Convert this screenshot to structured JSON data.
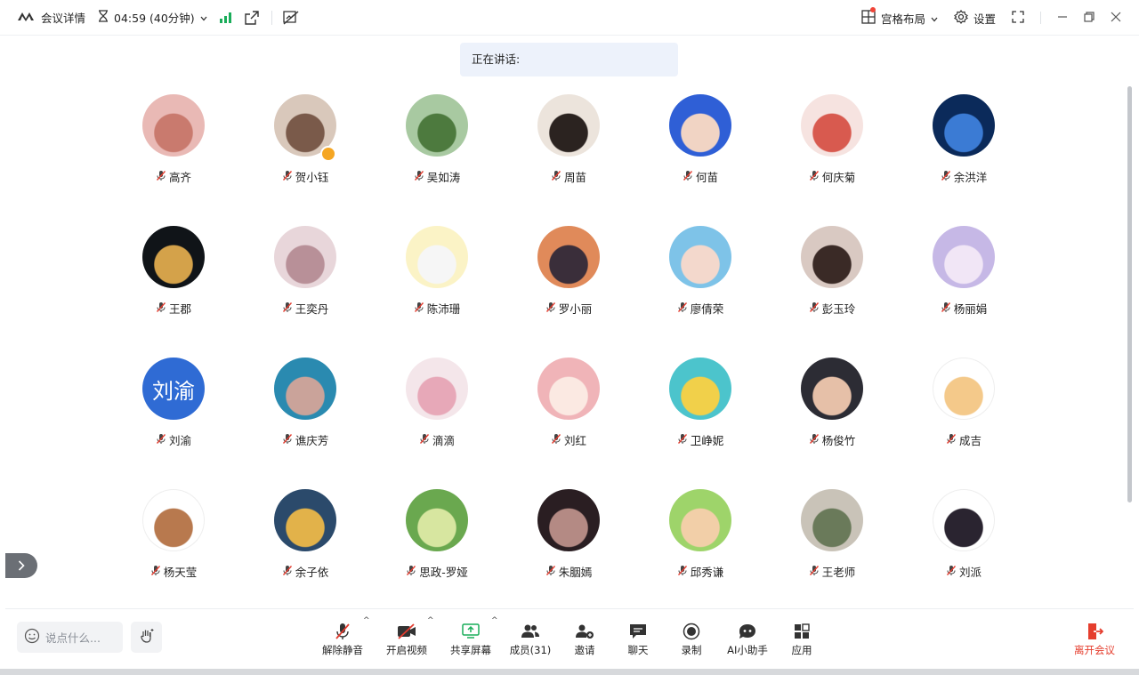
{
  "topbar": {
    "meeting_details": "会议详情",
    "timer": "04:59 (40分钟)",
    "layout_label": "宫格布局",
    "settings_label": "设置"
  },
  "speaking": {
    "label": "正在讲话:"
  },
  "participants": [
    {
      "name": "高齐",
      "avatar": "photo-toddler-pink"
    },
    {
      "name": "贺小钰",
      "avatar": "photo-girl-host"
    },
    {
      "name": "吴如涛",
      "avatar": "photo-man-grass"
    },
    {
      "name": "周苗",
      "avatar": "photo-black-cat"
    },
    {
      "name": "何苗",
      "avatar": "illustration-blue-girl"
    },
    {
      "name": "何庆菊",
      "avatar": "illustration-cartoon-girl"
    },
    {
      "name": "余洪洋",
      "avatar": "photo-earth"
    },
    {
      "name": "王郡",
      "avatar": "photo-clock-tower-night"
    },
    {
      "name": "王奕丹",
      "avatar": "illustration-princess"
    },
    {
      "name": "陈沛珊",
      "avatar": "illustration-white-rabbit"
    },
    {
      "name": "罗小丽",
      "avatar": "photo-sunset"
    },
    {
      "name": "廖倩荣",
      "avatar": "photo-girl-beach"
    },
    {
      "name": "彭玉玲",
      "avatar": "photo-girl-hands"
    },
    {
      "name": "杨丽娟",
      "avatar": "photo-pink-snowfield"
    },
    {
      "name": "刘渝",
      "avatar_text": "刘渝"
    },
    {
      "name": "谯庆芳",
      "avatar": "photo-blue-veil"
    },
    {
      "name": "滴滴",
      "avatar": "photo-baby-bunny"
    },
    {
      "name": "刘红",
      "avatar": "illustration-glasses-girl"
    },
    {
      "name": "卫峥妮",
      "avatar": "illustration-flower-teal"
    },
    {
      "name": "杨俊竹",
      "avatar": "photo-smiling-boy"
    },
    {
      "name": "成吉",
      "avatar": "illustration-girl-overalls"
    },
    {
      "name": "杨天莹",
      "avatar": "illustration-coffee-girl"
    },
    {
      "name": "余子依",
      "avatar": "photo-street-bus"
    },
    {
      "name": "思政-罗娅",
      "avatar": "photo-green-hills"
    },
    {
      "name": "朱胭嫣",
      "avatar": "photo-woman-dark"
    },
    {
      "name": "邱秀谦",
      "avatar": "illustration-blonde-woman"
    },
    {
      "name": "王老师",
      "avatar": "photo-plant-vase"
    },
    {
      "name": "刘派",
      "avatar": "illustration-kuromi"
    }
  ],
  "chat": {
    "placeholder": "说点什么..."
  },
  "toolbar": {
    "unmute": "解除静音",
    "start_video": "开启视频",
    "share_screen": "共享屏幕",
    "members": "成员(31)",
    "invite": "邀请",
    "chat": "聊天",
    "record": "录制",
    "ai_assistant": "AI小助手",
    "apps": "应用",
    "leave": "离开会议"
  },
  "colors": {
    "accent": "#2f6bd4",
    "leave": "#e53e2e",
    "signal": "#1aad5a",
    "mute_red": "#e23b2e"
  }
}
